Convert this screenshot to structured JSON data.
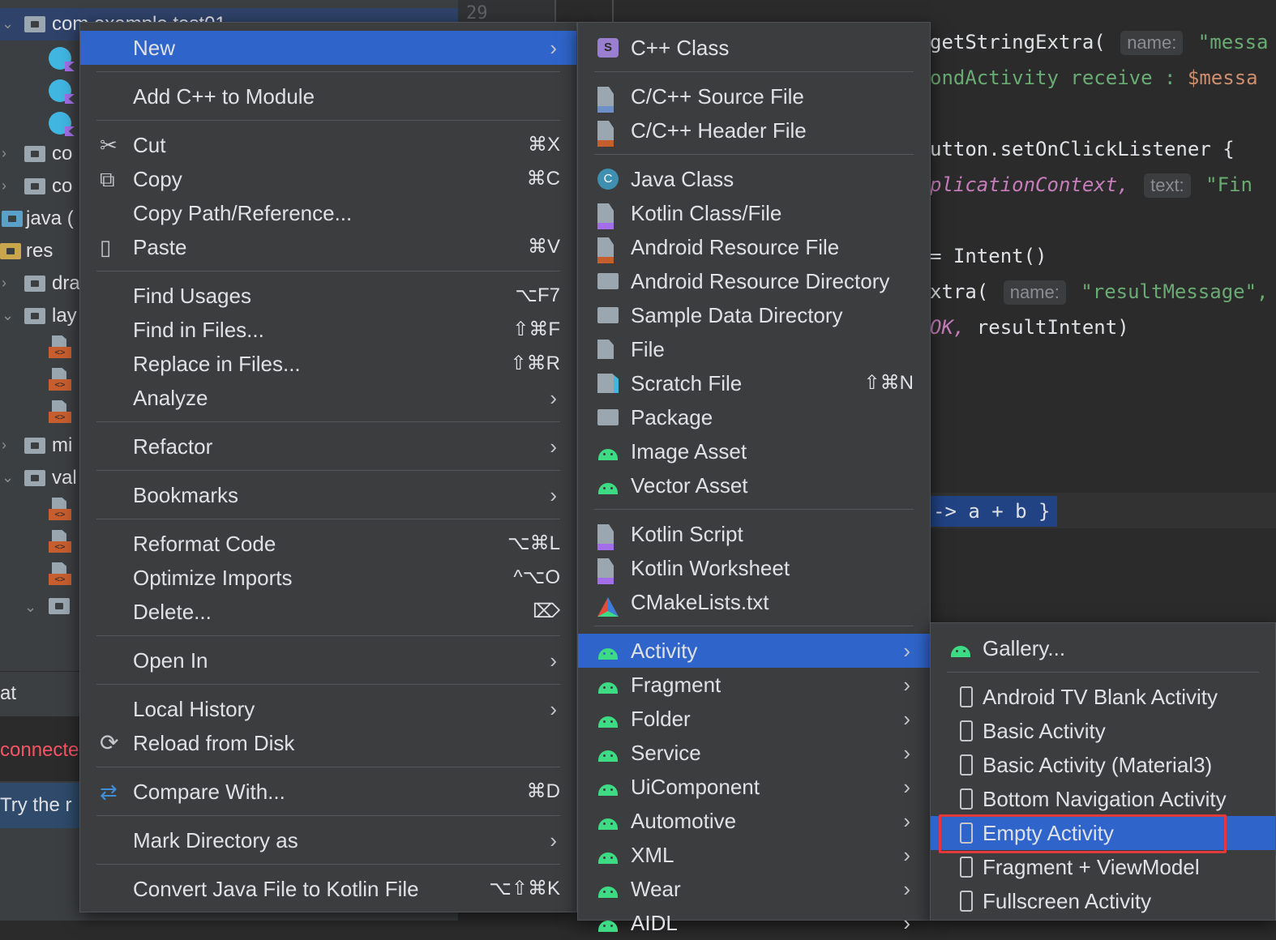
{
  "tree": {
    "selected_label": "com.example.test01",
    "items": [
      {
        "label": "co"
      },
      {
        "label": "co"
      },
      {
        "label": "java ("
      },
      {
        "label": "res"
      },
      {
        "label": "dra"
      },
      {
        "label": "lay"
      },
      {
        "label": "mi"
      },
      {
        "label": "val"
      }
    ],
    "line_number": "29",
    "bottom": {
      "at": "at",
      "connected": "connecte",
      "try": "Try the r"
    }
  },
  "editor": {
    "lines": [
      {
        "parts": [
          [
            "c-fn",
            "getStringExtra( "
          ],
          [
            "hint",
            "name:"
          ],
          [
            "c-str",
            " \"messa"
          ]
        ]
      },
      {
        "parts": [
          [
            "c-str",
            "ondActivity receive : "
          ],
          [
            "c-kw",
            "$messa"
          ]
        ]
      },
      {
        "parts": [
          [
            "c-fn",
            "utton.setOnClickListener {"
          ]
        ]
      },
      {
        "parts": [
          [
            "c-it",
            "plicationContext, "
          ],
          [
            "hint",
            "text:"
          ],
          [
            "c-str",
            " \"Fin"
          ]
        ]
      },
      {
        "parts": [
          [
            "c-fn",
            "= Intent()"
          ]
        ]
      },
      {
        "parts": [
          [
            "c-fn",
            "xtra( "
          ],
          [
            "hint",
            "name:"
          ],
          [
            "c-str",
            " \"resultMessage\","
          ]
        ]
      },
      {
        "parts": [
          [
            "c-it",
            "OK, "
          ],
          [
            "c-fn",
            "resultIntent)"
          ]
        ]
      }
    ],
    "lambda": "-> a + b }"
  },
  "menu1": {
    "items": [
      {
        "label": "New",
        "arrow": true,
        "selected": true,
        "name": "new"
      },
      {
        "sep": true
      },
      {
        "label": "Add C++ to Module",
        "name": "add-cpp-to-module"
      },
      {
        "sep": true
      },
      {
        "label": "Cut",
        "shortcut": "⌘X",
        "icon": "scissors-icon",
        "name": "cut"
      },
      {
        "label": "Copy",
        "shortcut": "⌘C",
        "icon": "copy-icon",
        "name": "copy"
      },
      {
        "label": "Copy Path/Reference...",
        "name": "copy-path"
      },
      {
        "label": "Paste",
        "shortcut": "⌘V",
        "icon": "clipboard-icon",
        "name": "paste"
      },
      {
        "sep": true
      },
      {
        "label": "Find Usages",
        "shortcut": "⌥F7",
        "name": "find-usages"
      },
      {
        "label": "Find in Files...",
        "shortcut": "⇧⌘F",
        "name": "find-in-files"
      },
      {
        "label": "Replace in Files...",
        "shortcut": "⇧⌘R",
        "name": "replace-in-files"
      },
      {
        "label": "Analyze",
        "arrow": true,
        "name": "analyze"
      },
      {
        "sep": true
      },
      {
        "label": "Refactor",
        "arrow": true,
        "name": "refactor"
      },
      {
        "sep": true
      },
      {
        "label": "Bookmarks",
        "arrow": true,
        "name": "bookmarks"
      },
      {
        "sep": true
      },
      {
        "label": "Reformat Code",
        "shortcut": "⌥⌘L",
        "name": "reformat-code"
      },
      {
        "label": "Optimize Imports",
        "shortcut": "^⌥O",
        "name": "optimize-imports"
      },
      {
        "label": "Delete...",
        "shortcut": "⌦",
        "name": "delete"
      },
      {
        "sep": true
      },
      {
        "label": "Open In",
        "arrow": true,
        "name": "open-in"
      },
      {
        "sep": true
      },
      {
        "label": "Local History",
        "arrow": true,
        "name": "local-history"
      },
      {
        "label": "Reload from Disk",
        "icon": "reload-icon",
        "name": "reload-from-disk"
      },
      {
        "sep": true
      },
      {
        "label": "Compare With...",
        "shortcut": "⌘D",
        "icon": "compare-icon",
        "name": "compare-with"
      },
      {
        "sep": true
      },
      {
        "label": "Mark Directory as",
        "arrow": true,
        "name": "mark-directory-as"
      },
      {
        "sep": true
      },
      {
        "label": "Convert Java File to Kotlin File",
        "shortcut": "⌥⇧⌘K",
        "name": "convert-java-to-kotlin"
      }
    ]
  },
  "menu2": {
    "items": [
      {
        "label": "C++ Class",
        "icon": "cpp-class-icon",
        "name": "cpp-class"
      },
      {
        "sep": true
      },
      {
        "label": "C/C++ Source File",
        "icon": "cpp-source-icon",
        "name": "cpp-source-file"
      },
      {
        "label": "C/C++ Header File",
        "icon": "cpp-header-icon",
        "name": "cpp-header-file"
      },
      {
        "sep": true
      },
      {
        "label": "Java Class",
        "icon": "java-class-icon",
        "name": "java-class"
      },
      {
        "label": "Kotlin Class/File",
        "icon": "kotlin-file-icon",
        "name": "kotlin-class-file"
      },
      {
        "label": "Android Resource File",
        "icon": "resource-file-icon",
        "name": "android-resource-file"
      },
      {
        "label": "Android Resource Directory",
        "icon": "folder-icon",
        "name": "android-resource-directory"
      },
      {
        "label": "Sample Data Directory",
        "icon": "folder-icon",
        "name": "sample-data-directory"
      },
      {
        "label": "File",
        "icon": "file-icon",
        "name": "file"
      },
      {
        "label": "Scratch File",
        "shortcut": "⇧⌘N",
        "icon": "scratch-file-icon",
        "name": "scratch-file"
      },
      {
        "label": "Package",
        "icon": "package-icon",
        "name": "package"
      },
      {
        "label": "Image Asset",
        "icon": "android-icon",
        "name": "image-asset"
      },
      {
        "label": "Vector Asset",
        "icon": "android-icon",
        "name": "vector-asset"
      },
      {
        "sep": true
      },
      {
        "label": "Kotlin Script",
        "icon": "kotlin-script-icon",
        "name": "kotlin-script"
      },
      {
        "label": "Kotlin Worksheet",
        "icon": "kotlin-worksheet-icon",
        "name": "kotlin-worksheet"
      },
      {
        "label": "CMakeLists.txt",
        "icon": "cmake-icon",
        "name": "cmakelists"
      },
      {
        "sep": true
      },
      {
        "label": "Activity",
        "arrow": true,
        "selected": true,
        "icon": "android-icon",
        "name": "activity"
      },
      {
        "label": "Fragment",
        "arrow": true,
        "icon": "android-icon",
        "name": "fragment"
      },
      {
        "label": "Folder",
        "arrow": true,
        "icon": "android-icon",
        "name": "folder"
      },
      {
        "label": "Service",
        "arrow": true,
        "icon": "android-icon",
        "name": "service"
      },
      {
        "label": "UiComponent",
        "arrow": true,
        "icon": "android-icon",
        "name": "uicomponent"
      },
      {
        "label": "Automotive",
        "arrow": true,
        "icon": "android-icon",
        "name": "automotive"
      },
      {
        "label": "XML",
        "arrow": true,
        "icon": "android-icon",
        "name": "xml"
      },
      {
        "label": "Wear",
        "arrow": true,
        "icon": "android-icon",
        "name": "wear"
      },
      {
        "label": "AIDL",
        "arrow": true,
        "icon": "android-icon",
        "name": "aidl"
      }
    ]
  },
  "menu3": {
    "items": [
      {
        "label": "Gallery...",
        "icon": "android-icon",
        "name": "gallery"
      },
      {
        "sep": true
      },
      {
        "label": "Android TV Blank Activity",
        "icon": "phone-icon",
        "name": "android-tv-blank-activity"
      },
      {
        "label": "Basic Activity",
        "icon": "phone-icon",
        "name": "basic-activity"
      },
      {
        "label": "Basic Activity (Material3)",
        "icon": "phone-icon",
        "name": "basic-activity-material3"
      },
      {
        "label": "Bottom Navigation Activity",
        "icon": "phone-icon",
        "name": "bottom-navigation-activity"
      },
      {
        "label": "Empty Activity",
        "icon": "phone-icon",
        "selected": true,
        "name": "empty-activity"
      },
      {
        "label": "Fragment + ViewModel",
        "icon": "phone-icon",
        "name": "fragment-viewmodel"
      },
      {
        "label": "Fullscreen Activity",
        "icon": "phone-icon",
        "name": "fullscreen-activity"
      }
    ]
  },
  "colors": {
    "selection": "#2f65ca",
    "menu_bg": "#3b3d3f",
    "highlight_border": "#e03a3a",
    "android_green": "#3ddc84"
  }
}
